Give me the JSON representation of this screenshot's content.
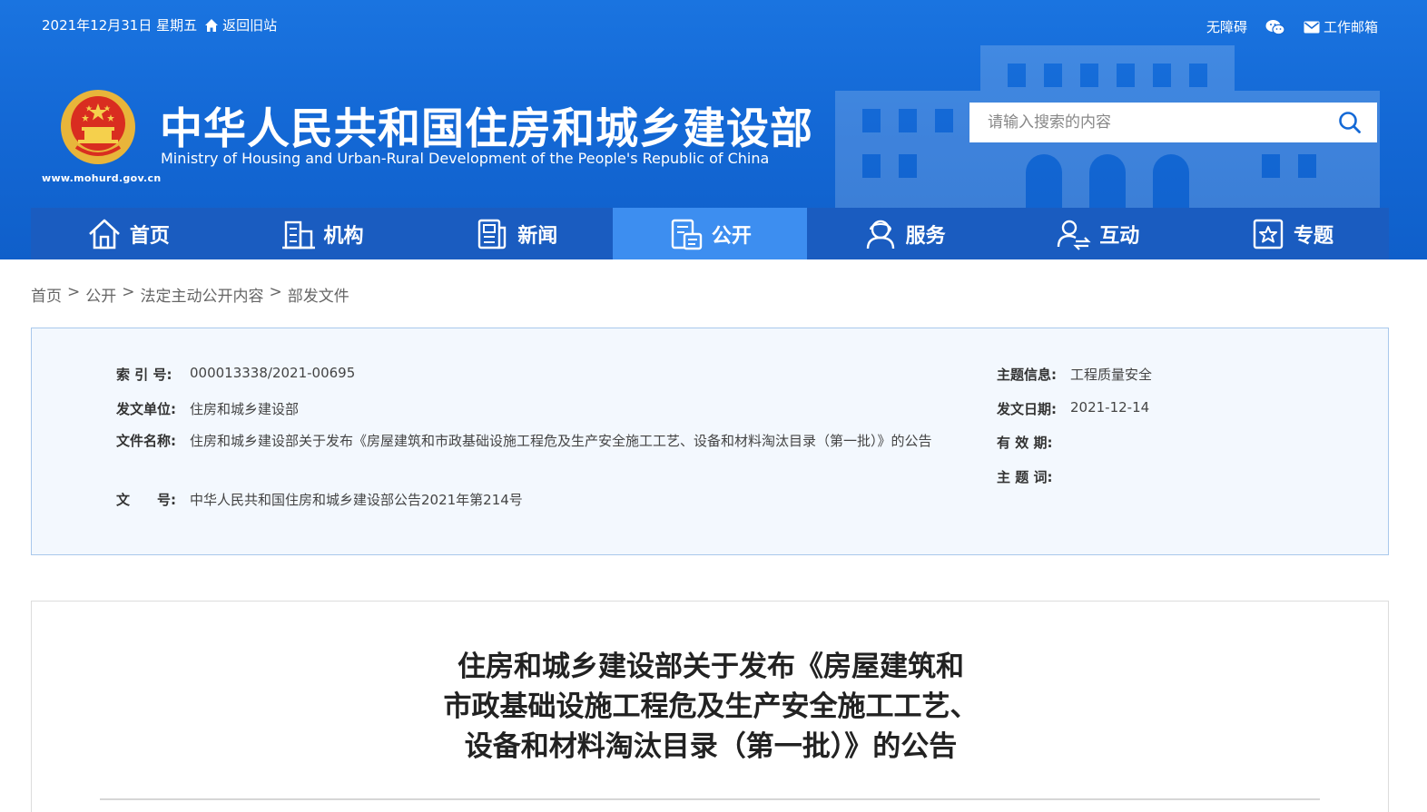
{
  "topbar": {
    "date": "2021年12月31日 星期五",
    "back_old": "返回旧站",
    "accessibility": "无障碍",
    "mail": "工作邮箱"
  },
  "header": {
    "title_cn": "中华人民共和国住房和城乡建设部",
    "title_en": "Ministry of Housing and Urban-Rural Development of the People's Republic of China",
    "site_url": "www.mohurd.gov.cn"
  },
  "search": {
    "placeholder": "请输入搜索的内容"
  },
  "nav": [
    {
      "label": "首页",
      "icon": "home-icon"
    },
    {
      "label": "机构",
      "icon": "building-icon"
    },
    {
      "label": "新闻",
      "icon": "news-icon"
    },
    {
      "label": "公开",
      "icon": "disclosure-icon",
      "active": true
    },
    {
      "label": "服务",
      "icon": "service-icon"
    },
    {
      "label": "互动",
      "icon": "interaction-icon"
    },
    {
      "label": "专题",
      "icon": "topic-icon"
    }
  ],
  "breadcrumb": [
    "首页",
    "公开",
    "法定主动公开内容",
    "部发文件"
  ],
  "info": {
    "index_label": "索 引 号:",
    "index_value": "000013338/2021-00695",
    "unit_label": "发文单位:",
    "unit_value": "住房和城乡建设部",
    "name_label": "文件名称:",
    "name_value": "住房和城乡建设部关于发布《房屋建筑和市政基础设施工程危及生产安全施工工艺、设备和材料淘汰目录（第一批）》的公告",
    "docno_label": "文　　号:",
    "docno_value": "中华人民共和国住房和城乡建设部公告2021年第214号",
    "topic_label": "主题信息:",
    "topic_value": "工程质量安全",
    "date_label": "发文日期:",
    "date_value": "2021-12-14",
    "validity_label": "有 效 期:",
    "validity_value": "",
    "keywords_label": "主 题 词:",
    "keywords_value": ""
  },
  "article": {
    "title_lines": [
      "住房和城乡建设部关于发布《房屋建筑和",
      "市政基础设施工程危及生产安全施工工艺、",
      "设备和材料淘汰目录（第一批）》的公告"
    ]
  },
  "colors": {
    "header_blue": "#1469d6",
    "nav_blue": "#1a5cc0",
    "nav_active": "#3d8ef0",
    "info_bg": "#f3f8fe",
    "info_border": "#a9c8ec"
  }
}
